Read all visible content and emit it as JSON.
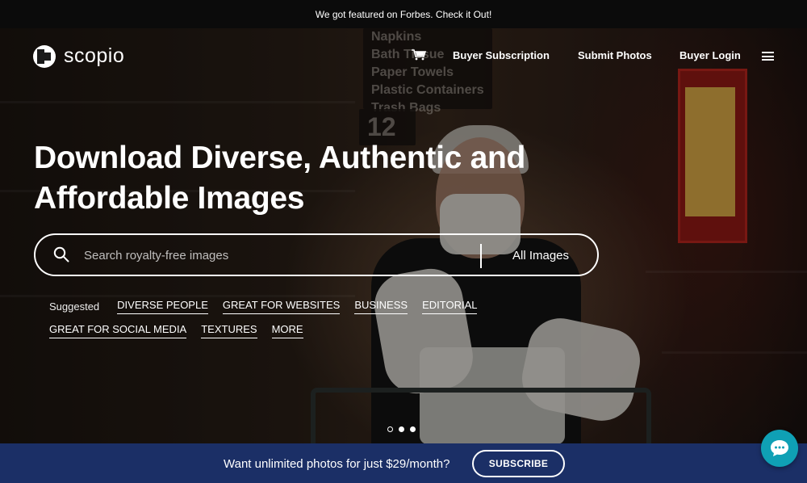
{
  "announcement": {
    "text": "We got featured on Forbes. Check it Out!"
  },
  "nav": {
    "logo_text": "scopio",
    "links": [
      "Buyer Subscription",
      "Submit Photos",
      "Buyer Login"
    ]
  },
  "hero": {
    "headline_line1": "Download Diverse, Authentic and",
    "headline_line2": "Affordable Images",
    "background_signs": [
      "Napkins",
      "Bath Tissue",
      "Paper Towels",
      "Plastic Containers",
      "Trash Bags",
      "12"
    ]
  },
  "search": {
    "placeholder": "Search royalty-free images",
    "scope_label": "All Images"
  },
  "suggested": {
    "label": "Suggested",
    "tags_row1": [
      "DIVERSE PEOPLE",
      "GREAT FOR WEBSITES",
      "BUSINESS",
      "EDITORIAL"
    ],
    "tags_row2": [
      "GREAT FOR SOCIAL MEDIA",
      "TEXTURES",
      "MORE"
    ]
  },
  "carousel": {
    "dot_count": 3,
    "active_index": 0
  },
  "promo": {
    "text": "Want unlimited photos for just $29/month?",
    "button_label": "SUBSCRIBE"
  },
  "colors": {
    "promo_bar": "#1b2f66",
    "chat_button": "#0fa0b5",
    "announcement_bar": "#0b0b0b"
  },
  "icons": {
    "logo": "scopio-logo-icon",
    "cart": "cart-icon",
    "menu": "hamburger-icon",
    "search": "search-icon",
    "chat": "chat-icon"
  }
}
